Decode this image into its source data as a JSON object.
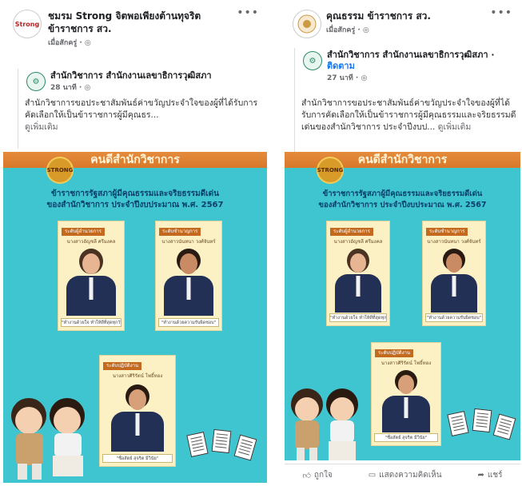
{
  "left_post": {
    "page_name": "ชมรม Strong จิตพอเพียงต้านทุจริต ข้าราชการ สว.",
    "avatar_text": "Strong",
    "meta": "เมื่อสักครู่ · ◎",
    "shared": {
      "name": "สำนักวิชาการ สำนักงานเลขาธิการวุฒิสภา",
      "meta": "28 นาที · ◎",
      "text": "สำนักวิชาการขอประชาสัมพันธ์ค่าขวัญประจำใจของผู้ที่ได้รับการคัดเลือกให้เป็นข้าราชการผู้มีคุณธร...",
      "see_more": "ดูเพิ่มเติม"
    }
  },
  "right_post": {
    "page_name": "คุณธรรม ข้าราชการ สว.",
    "meta": "เมื่อสักครู่ · ◎",
    "shared": {
      "name": "สำนักวิชาการ สำนักงานเลขาธิการวุฒิสภา",
      "follow": "ติดตาม",
      "meta": "27 นาที · ◎",
      "text": "สำนักวิชาการขอประชาสัมพันธ์ค่าขวัญประจำใจของผู้ที่ได้รับการคัดเลือกให้เป็นข้าราชการผู้มีคุณธรรมและจริยธรรมดีเด่นของสำนักวิชาการ ประจำปีงบป...",
      "see_more": "ดูเพิ่มเติม"
    },
    "actions": {
      "like": "ถูกใจ",
      "comment": "แสดงความคิดเห็น",
      "share": "แชร์"
    }
  },
  "poster": {
    "banner": "คนดีสำนักวิชาการ",
    "badge": "STRONG",
    "title_line1": "ข้าราชการรัฐสภาผู้มีคุณธรรมและจริยธรรมดีเด่น",
    "title_line2": "ของสำนักวิชาการ ประจำปีงบประมาณ พ.ศ. 2567",
    "cards": [
      {
        "label": "ระดับผู้อำนวยการ",
        "name": "นางสาวอัญชลี ศรีมงคล",
        "foot": "\"ทำงานด้วยใจ ทำให้ดีที่สุดทุกวัน\""
      },
      {
        "label": "ระดับชำนาญการ",
        "name": "นางสาวนันทนา วงศ์จันทร์",
        "foot": "\"ทำงานด้วยความรับผิดชอบ\""
      },
      {
        "label": "ระดับปฏิบัติงาน",
        "name": "นางสาวศิริรัตน์ โพธิ์ทอง",
        "foot": "\"ซื่อสัตย์ สุจริต มีวินัย\""
      }
    ]
  },
  "colors": {
    "poster_bg": "#3fc5cf",
    "banner": "#e48c3c",
    "title": "#0b3e6d",
    "card": "#fbf1c5",
    "link": "#1877f2"
  }
}
